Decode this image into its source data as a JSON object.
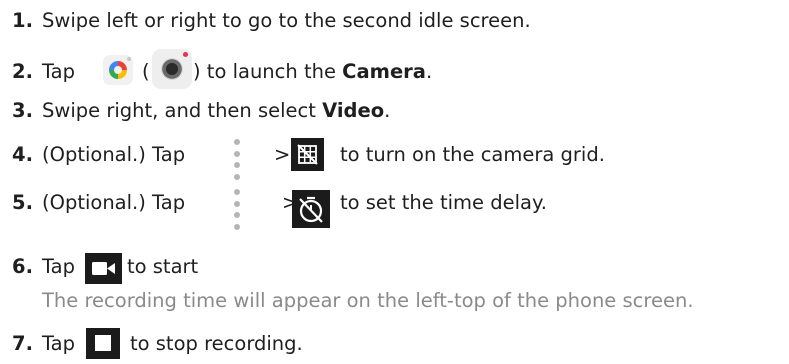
{
  "steps": [
    {
      "number": "1.",
      "text": "Swipe left or right to go to the second idle screen."
    },
    {
      "number": "2.",
      "pre": "Tap",
      "mid": "(",
      "post": ") to launch the",
      "bold": "Camera",
      "end": "."
    },
    {
      "number": "3.",
      "pre": "Swipe right, and then select",
      "bold": "Video",
      "end": "."
    },
    {
      "number": "4.",
      "pre": "(Optional.) Tap",
      "sep": ">",
      "post": "to turn on the camera grid."
    },
    {
      "number": "5.",
      "pre": "(Optional.) Tap",
      "sep": ">",
      "post": "to set the time delay."
    },
    {
      "number": "6.",
      "pre": "Tap",
      "post": "to start"
    },
    {
      "number": "7.",
      "pre": "Tap",
      "post": "to stop recording."
    }
  ],
  "note": "The recording time will appear on the left-top of the phone screen.",
  "icons": {
    "camera_app_a": "camera-app-icon",
    "camera_app_b": "camera-lens-icon",
    "more_options": "more-options-icon",
    "grid_off": "grid-off-icon",
    "timer_off": "timer-off-icon",
    "record_video": "video-record-icon",
    "stop": "stop-icon"
  },
  "colors": {
    "text": "#1f1f1f",
    "note": "#8a8a8a",
    "icon_dark": "#1b1b1b",
    "badge_red": "#e2364d"
  }
}
